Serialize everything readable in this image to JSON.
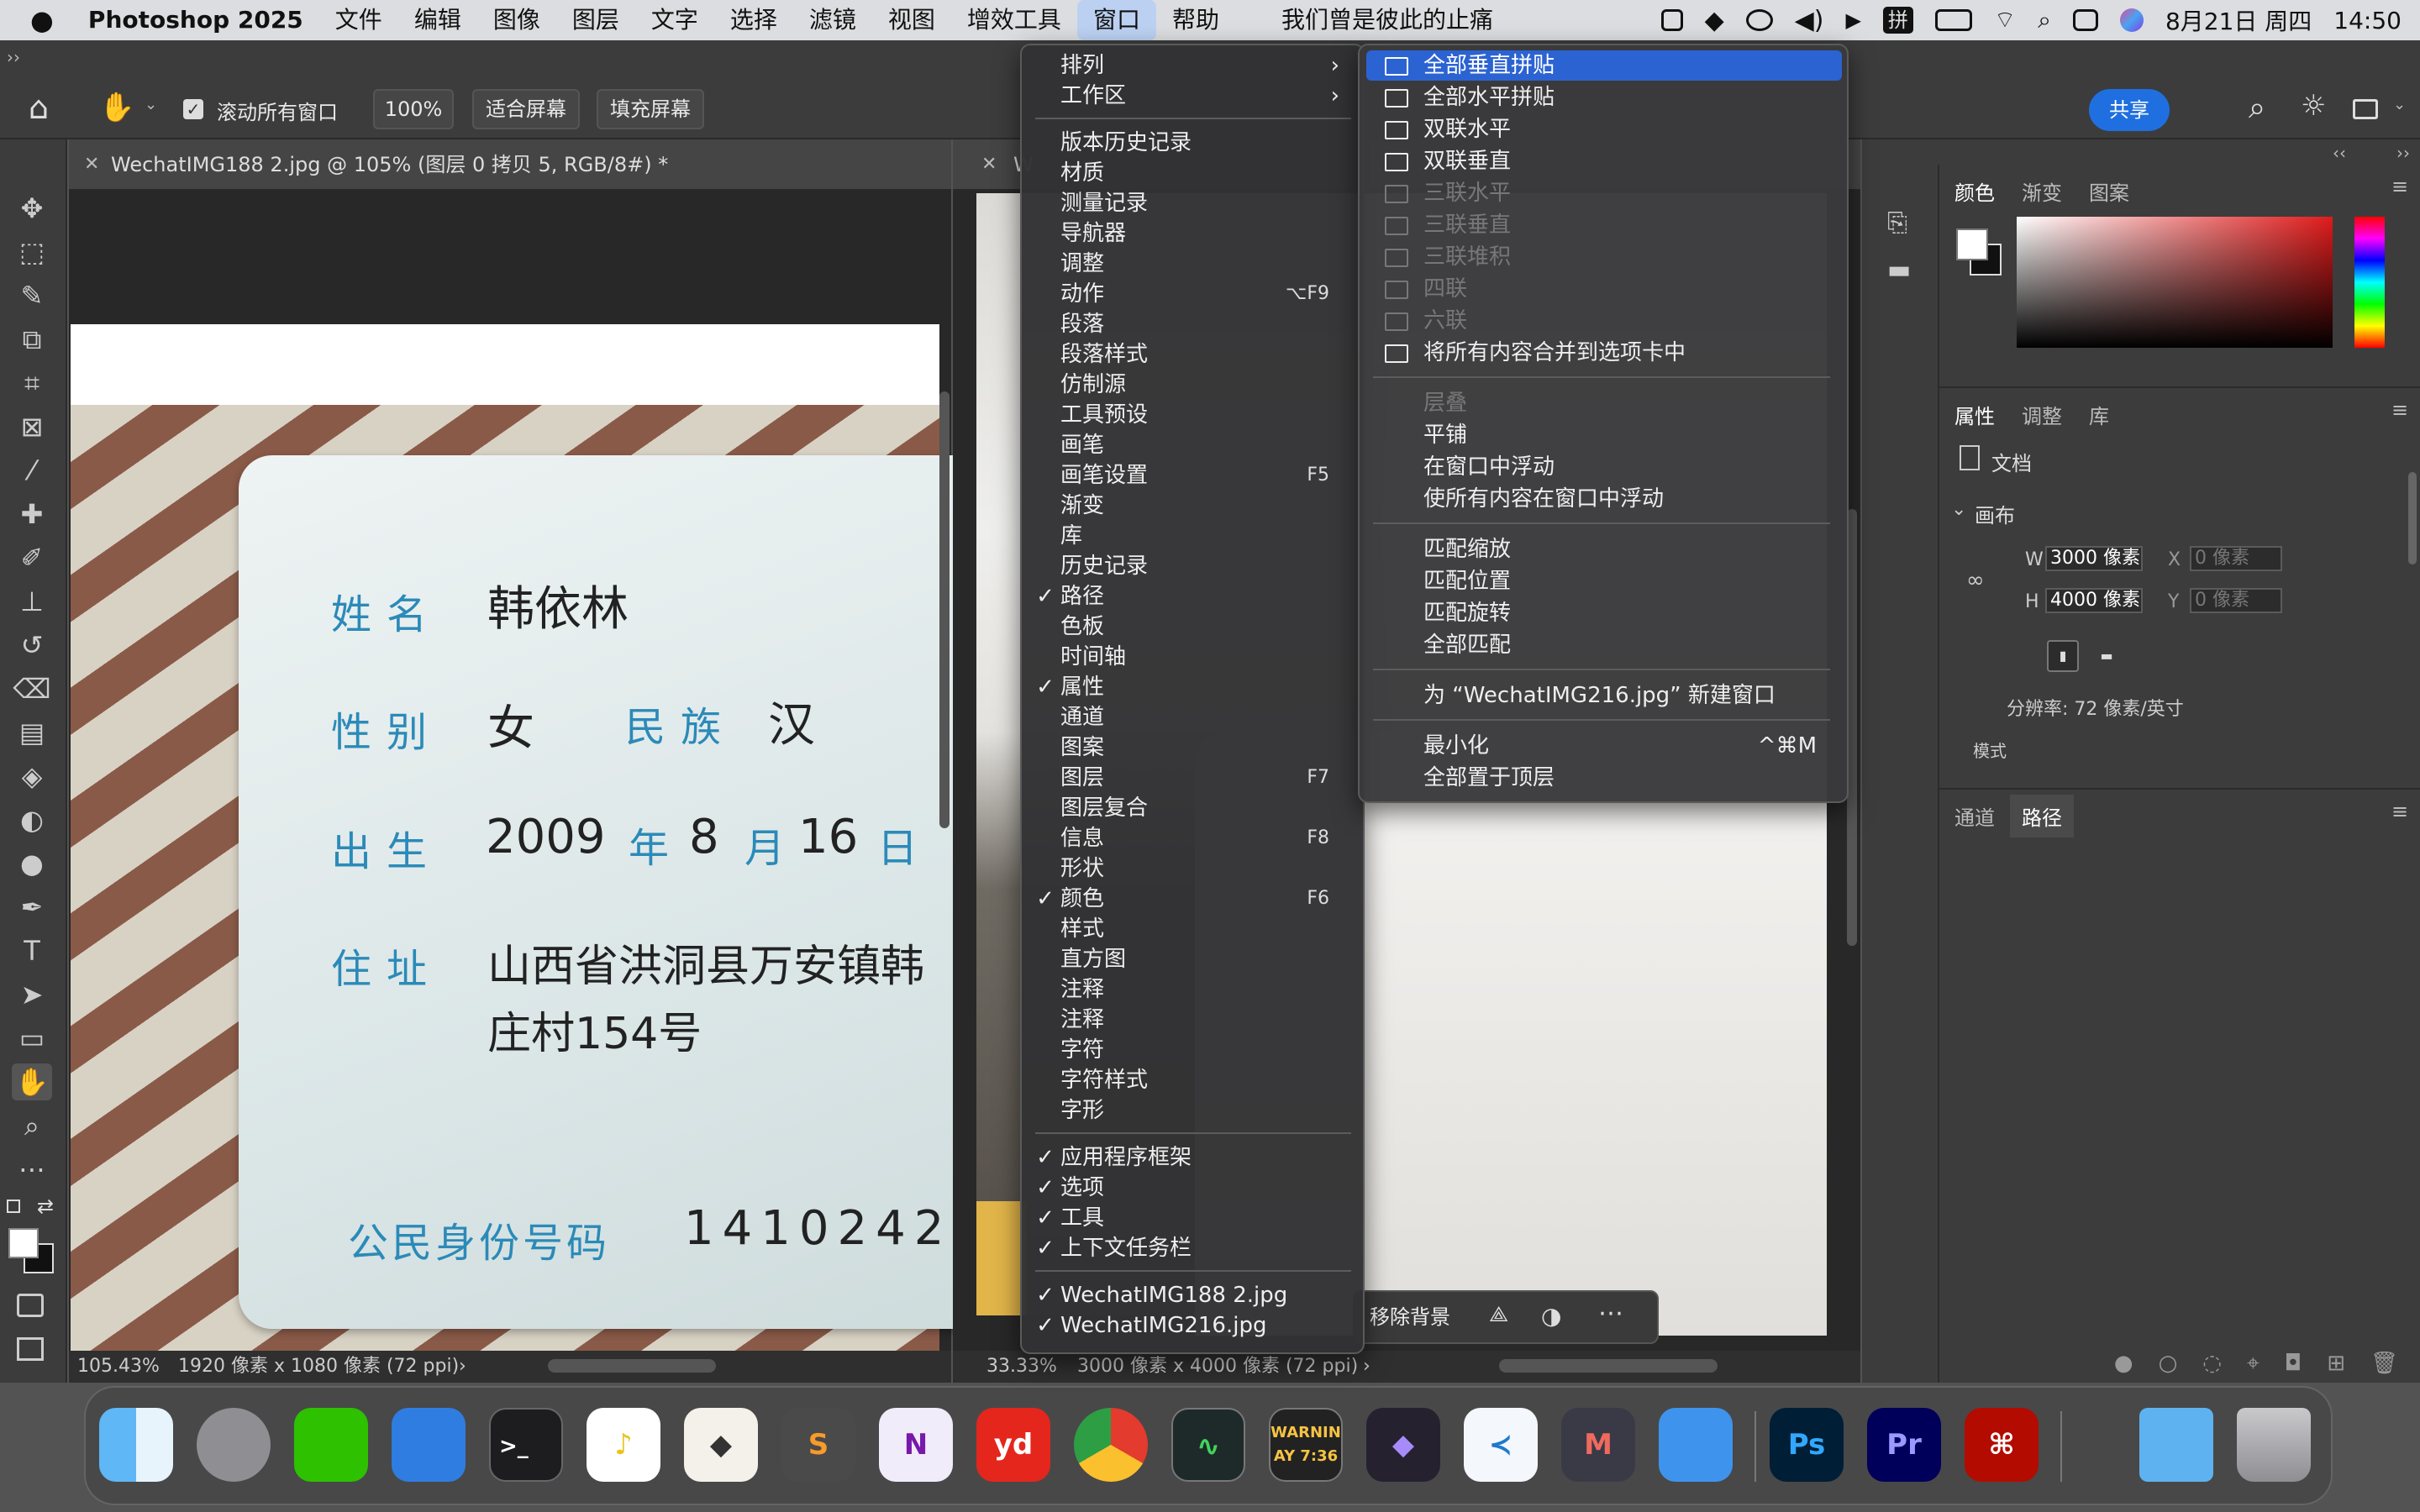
{
  "menubar": {
    "app_name": "Photoshop 2025",
    "items": [
      "文件",
      "编辑",
      "图像",
      "图层",
      "文字",
      "选择",
      "滤镜",
      "视图",
      "增效工具",
      "窗口",
      "帮助"
    ],
    "now_playing": "我们曾是彼此的止痛",
    "input_method": "拼",
    "date": "8月21日 周四",
    "time": "14:50"
  },
  "options": {
    "scroll_all_label": "滚动所有窗口",
    "zoom_100": "100%",
    "fit_screen": "适合屏幕",
    "fill_screen": "填充屏幕",
    "share": "共享"
  },
  "docL": {
    "tab_title": "WechatIMG188 2.jpg @ 105% (图层 0 拷贝 5, RGB/8#) *",
    "zoom": "105.43%",
    "info": "1920 像素 x 1080 像素 (72 ppi)",
    "card": {
      "name_label": "姓名",
      "name": "韩依林",
      "sex_label": "性别",
      "sex": "女",
      "ethnic_label": "民族",
      "ethnic": "汉",
      "birth_label": "出生",
      "birth_year": "2009",
      "year": "年",
      "birth_month": "8",
      "month": "月",
      "birth_day": "16",
      "day": "日",
      "address_label": "住址",
      "address_1": "山西省洪洞县万安镇韩",
      "address_2": "庄村154号",
      "id_label": "公民身份号码",
      "id_number": "1410242"
    }
  },
  "docR": {
    "tab_title": "W",
    "zoom": "33.33%",
    "info": "3000 像素 x 4000 像素 (72 ppi)",
    "remove_bg": "移除背景"
  },
  "window_menu": {
    "items": [
      {
        "label": "排列",
        "submenu": true
      },
      {
        "label": "工作区",
        "submenu": true
      },
      {
        "sep": true
      },
      {
        "label": "版本历史记录"
      },
      {
        "label": "材质"
      },
      {
        "label": "测量记录"
      },
      {
        "label": "导航器"
      },
      {
        "label": "调整"
      },
      {
        "label": "动作",
        "shortcut": "⌥F9"
      },
      {
        "label": "段落"
      },
      {
        "label": "段落样式"
      },
      {
        "label": "仿制源"
      },
      {
        "label": "工具预设"
      },
      {
        "label": "画笔"
      },
      {
        "label": "画笔设置",
        "shortcut": "F5"
      },
      {
        "label": "渐变"
      },
      {
        "label": "库"
      },
      {
        "label": "历史记录"
      },
      {
        "label": "路径",
        "checked": true
      },
      {
        "label": "色板"
      },
      {
        "label": "时间轴"
      },
      {
        "label": "属性",
        "checked": true
      },
      {
        "label": "通道"
      },
      {
        "label": "图案"
      },
      {
        "label": "图层",
        "shortcut": "F7"
      },
      {
        "label": "图层复合"
      },
      {
        "label": "信息",
        "shortcut": "F8"
      },
      {
        "label": "形状"
      },
      {
        "label": "颜色",
        "checked": true,
        "shortcut": "F6"
      },
      {
        "label": "样式"
      },
      {
        "label": "直方图"
      },
      {
        "label": "注释"
      },
      {
        "label": "注释"
      },
      {
        "label": "字符"
      },
      {
        "label": "字符样式"
      },
      {
        "label": "字形"
      },
      {
        "sep": true
      },
      {
        "label": "应用程序框架",
        "checked": true
      },
      {
        "label": "选项",
        "checked": true
      },
      {
        "label": "工具",
        "checked": true
      },
      {
        "label": "上下文任务栏",
        "checked": true
      },
      {
        "sep": true
      },
      {
        "label": "WechatIMG188 2.jpg",
        "checked": true
      },
      {
        "label": "WechatIMG216.jpg",
        "checked": true
      }
    ]
  },
  "arrange_menu": {
    "items": [
      {
        "label": "全部垂直拼贴",
        "icon": "vertical-tile",
        "highlight": true
      },
      {
        "label": "全部水平拼贴",
        "icon": "horizontal-tile"
      },
      {
        "label": "双联水平",
        "icon": "two-up-horizontal"
      },
      {
        "label": "双联垂直",
        "icon": "two-up-vertical"
      },
      {
        "label": "三联水平",
        "icon": "three-up-horizontal",
        "disabled": true
      },
      {
        "label": "三联垂直",
        "icon": "three-up-vertical",
        "disabled": true
      },
      {
        "label": "三联堆积",
        "icon": "three-up-stacked",
        "disabled": true
      },
      {
        "label": "四联",
        "icon": "four-up",
        "disabled": true
      },
      {
        "label": "六联",
        "icon": "six-up",
        "disabled": true
      },
      {
        "label": "将所有内容合并到选项卡中",
        "icon": "consolidate"
      },
      {
        "sep": true
      },
      {
        "label": "层叠",
        "disabled": true
      },
      {
        "label": "平铺"
      },
      {
        "label": "在窗口中浮动"
      },
      {
        "label": "使所有内容在窗口中浮动"
      },
      {
        "sep": true
      },
      {
        "label": "匹配缩放"
      },
      {
        "label": "匹配位置"
      },
      {
        "label": "匹配旋转"
      },
      {
        "label": "全部匹配"
      },
      {
        "sep": true
      },
      {
        "label": "为 “WechatIMG216.jpg” 新建窗口"
      },
      {
        "sep": true
      },
      {
        "label": "最小化",
        "shortcut": "^⌘M"
      },
      {
        "label": "全部置于顶层"
      }
    ]
  },
  "panels": {
    "color_tabs": [
      "颜色",
      "渐变",
      "图案"
    ],
    "prop_tabs": [
      "属性",
      "调整",
      "库"
    ],
    "doc_label": "文档",
    "canvas_label": "画布",
    "w_label": "W",
    "w_value": "3000 像素",
    "h_label": "H",
    "h_value": "4000 像素",
    "x_label": "X",
    "x_value": "0 像素",
    "y_label": "Y",
    "y_value": "0 像素",
    "resolution": "分辨率: 72 像素/英寸",
    "mode": "模式",
    "path_tabs": [
      "通道",
      "路径"
    ]
  },
  "dock": {
    "warning_line1": "WARNIN",
    "warning_line2": "AY 7:36",
    "ps": "Ps",
    "pr": "Pr",
    "yd": "yd"
  }
}
